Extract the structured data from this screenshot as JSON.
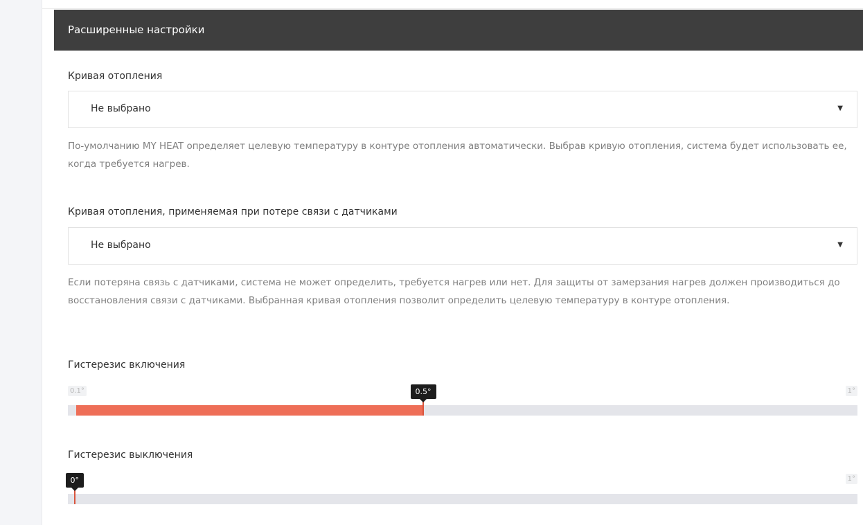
{
  "panel": {
    "title": "Расширенные настройки"
  },
  "heating_curve": {
    "label": "Кривая отопления",
    "selected": "Не выбрано",
    "hint": "По-умолчанию MY HEAT определяет целевую температуру в контуре отопления автоматически. Выбрав кривую отопления, система будет использовать ее, когда требуется нагрев."
  },
  "fallback_curve": {
    "label": "Кривая отопления, применяемая при потере связи с датчиками",
    "selected": "Не выбрано",
    "hint": "Если потеряна связь с датчиками, система не может определить, требуется нагрев или нет. Для защиты от замерзания нагрев должен производиться до восстановления связи с датчиками. Выбранная кривая отопления позволит определить целевую температуру в контуре отопления."
  },
  "hysteresis_on": {
    "label": "Гистерезис включения",
    "min_label": "0.1°",
    "max_label": "1°",
    "value_label": "0.5°",
    "min": 0.1,
    "max": 1,
    "value": 0.5
  },
  "hysteresis_off": {
    "label": "Гистерезис выключения",
    "max_label": "1°",
    "value_label": "0°",
    "min": 0,
    "max": 1,
    "value": 0
  },
  "colors": {
    "header_bg": "#3e3e3e",
    "slider_fill": "#ee6e57",
    "slider_track": "#e4e5ea"
  },
  "icons": {
    "dropdown": "caret-down-icon"
  }
}
